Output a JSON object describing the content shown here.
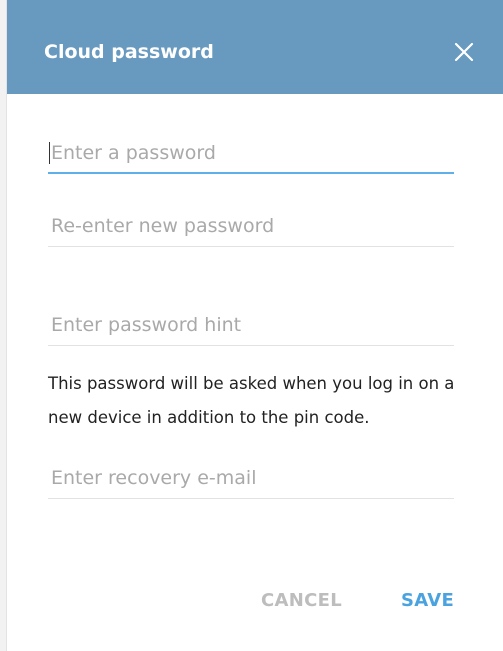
{
  "dialog": {
    "title": "Cloud password",
    "close_icon": "close-icon",
    "colors": {
      "header": "#6899bf",
      "active_underline": "#5fb0e8",
      "save": "#4aa3df",
      "cancel": "#bdbdbd"
    }
  },
  "form": {
    "password": {
      "placeholder": "Enter a password",
      "value": ""
    },
    "confirm_password": {
      "placeholder": "Re-enter new password",
      "value": ""
    },
    "hint": {
      "placeholder": "Enter password hint",
      "value": ""
    },
    "info_text": "This password will be asked when you log in on a new device in addition to the pin code.",
    "recovery_email": {
      "placeholder": "Enter recovery e-mail",
      "value": ""
    }
  },
  "actions": {
    "cancel_label": "CANCEL",
    "save_label": "SAVE"
  }
}
